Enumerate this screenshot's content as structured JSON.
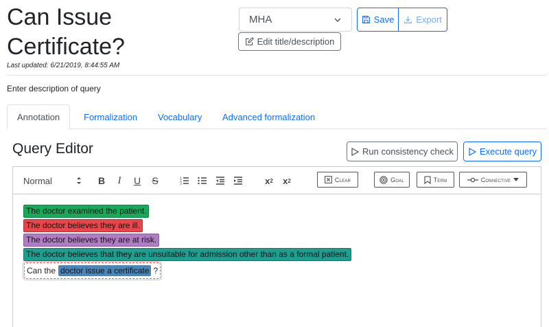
{
  "page": {
    "title": "Can Issue Certificate?",
    "last_updated": "Last updated: 6/21/2019, 8:44:55 AM",
    "description": "Enter description of query"
  },
  "header": {
    "dataset_select": {
      "value": "MHA"
    },
    "save_label": "Save",
    "export_label": "Export",
    "edit_label": "Edit title/description"
  },
  "tabs": [
    {
      "label": "Annotation",
      "active": true
    },
    {
      "label": "Formalization",
      "active": false
    },
    {
      "label": "Vocabulary",
      "active": false
    },
    {
      "label": "Advanced formalization",
      "active": false
    }
  ],
  "editor": {
    "title": "Query Editor",
    "consistency_label": "Run consistency check",
    "execute_label": "Execute query",
    "toolbar": {
      "style": "Normal",
      "bold": "B",
      "italic": "I",
      "underline": "U",
      "strike": "S",
      "clear": "Clear",
      "goal": "Goal",
      "term": "Term",
      "connective": "Connective"
    },
    "sentences": [
      {
        "text": "The doctor examined the patient.",
        "color": "#1aa85a"
      },
      {
        "text": "The doctor believes they are ill.",
        "color": "#e8464a"
      },
      {
        "text": "The doctor believes they are at risk.",
        "color": "#b07dc4"
      },
      {
        "text": "The doctor believes that they are unsuitable for admission other than as a formal patient.",
        "color": "#1f9e8f"
      }
    ],
    "query": {
      "prefix": "Can the",
      "term": "doctor issue a certificate",
      "suffix": "?"
    }
  },
  "colors": {
    "primary": "#0d6efd",
    "goal_border": "#d9534f",
    "term_bg": "#4a86b8"
  }
}
